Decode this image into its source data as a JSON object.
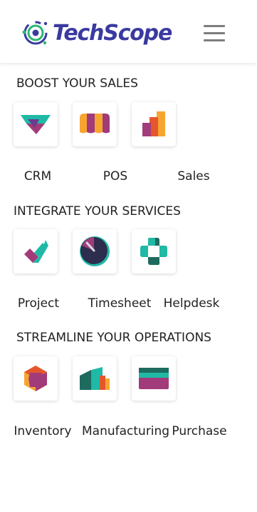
{
  "header": {
    "logo_text": "TechScope",
    "brand_color": "#3a3aa0",
    "menu_icon": "hamburger-icon"
  },
  "sections": [
    {
      "title": "BOOST YOUR SALES",
      "apps": [
        {
          "label": "CRM",
          "icon": "crm-icon"
        },
        {
          "label": "POS",
          "icon": "pos-icon"
        },
        {
          "label": "Sales",
          "icon": "sales-icon"
        }
      ]
    },
    {
      "title": "INTEGRATE YOUR SERVICES",
      "apps": [
        {
          "label": "Project",
          "icon": "project-icon"
        },
        {
          "label": "Timesheet",
          "icon": "timesheet-icon"
        },
        {
          "label": "Helpdesk",
          "icon": "helpdesk-icon"
        }
      ]
    },
    {
      "title": "STREAMLINE YOUR OPERATIONS",
      "apps": [
        {
          "label": "Inventory",
          "icon": "inventory-icon"
        },
        {
          "label": "Manufacturing",
          "icon": "manufacturing-icon"
        },
        {
          "label": "Purchase",
          "icon": "purchase-icon"
        }
      ]
    }
  ]
}
